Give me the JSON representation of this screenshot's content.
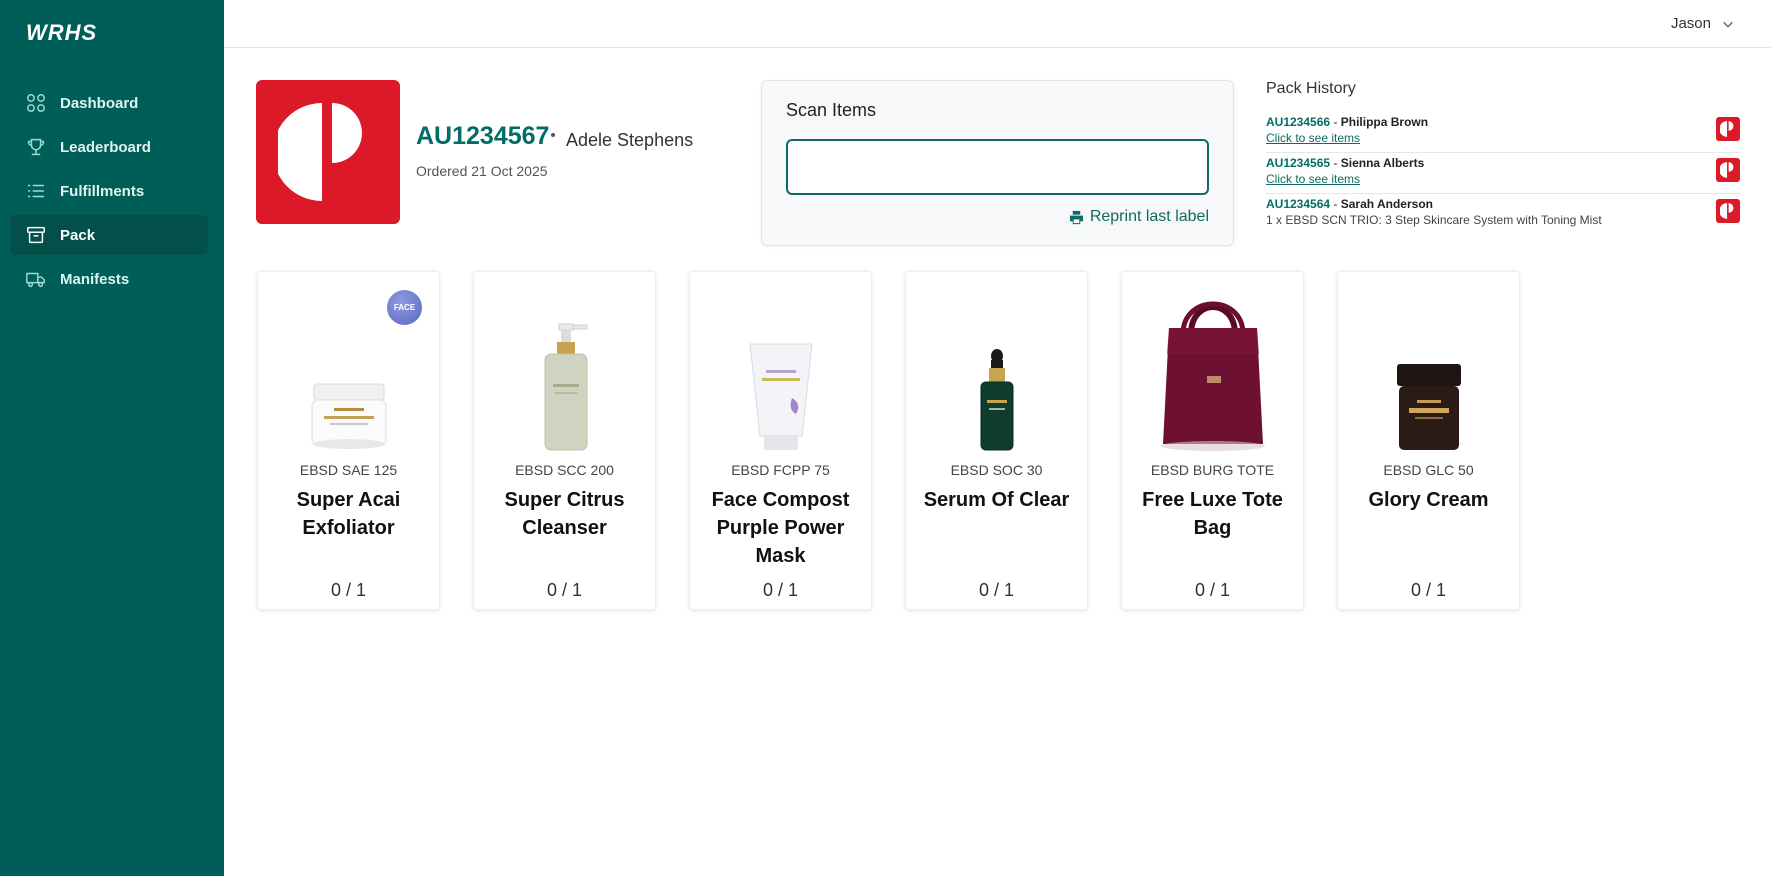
{
  "app": {
    "logo": "WRHS"
  },
  "sidebar": {
    "items": [
      {
        "label": "Dashboard",
        "icon": "grid-icon",
        "active": false
      },
      {
        "label": "Leaderboard",
        "icon": "trophy-icon",
        "active": false
      },
      {
        "label": "Fulfillments",
        "icon": "list-icon",
        "active": false
      },
      {
        "label": "Pack",
        "icon": "archive-box-icon",
        "active": true
      },
      {
        "label": "Manifests",
        "icon": "truck-icon",
        "active": false
      }
    ]
  },
  "header": {
    "user_name": "Jason"
  },
  "order": {
    "id": "AU1234567",
    "customer": "Adele Stephens",
    "ordered": "Ordered 21 Oct 2025",
    "carrier_color": "#dc1928"
  },
  "scan": {
    "title": "Scan Items",
    "value": "",
    "reprint_label": "Reprint last label"
  },
  "history": {
    "title": "Pack History",
    "rows": [
      {
        "id": "AU1234566",
        "name": "Philippa Brown",
        "link": "Click to see items"
      },
      {
        "id": "AU1234565",
        "name": "Sienna Alberts",
        "link": "Click to see items"
      },
      {
        "id": "AU1234564",
        "name": "Sarah Anderson",
        "desc": "1 x EBSD SCN TRIO: 3 Step Skincare System with Toning Mist"
      }
    ]
  },
  "products": [
    {
      "sku": "EBSD SAE 125",
      "name": "Super Acai Exfoliator",
      "qty": "0 / 1",
      "badge": "FACE",
      "image": "jar-white"
    },
    {
      "sku": "EBSD SCC 200",
      "name": "Super Citrus Cleanser",
      "qty": "0 / 1",
      "image": "pump-bottle"
    },
    {
      "sku": "EBSD FCPP 75",
      "name": "Face Compost Purple Power Mask",
      "qty": "0 / 1",
      "image": "tube"
    },
    {
      "sku": "EBSD SOC 30",
      "name": "Serum Of Clear",
      "qty": "0 / 1",
      "image": "dropper-bottle"
    },
    {
      "sku": "EBSD BURG TOTE",
      "name": "Free Luxe Tote Bag",
      "qty": "0 / 1",
      "image": "tote-bag"
    },
    {
      "sku": "EBSD GLC 50",
      "name": "Glory Cream",
      "qty": "0 / 1",
      "image": "jar-dark"
    }
  ],
  "colors": {
    "sidebar": "#005e58",
    "accent": "#006e66",
    "carrier_red": "#dc1928"
  }
}
